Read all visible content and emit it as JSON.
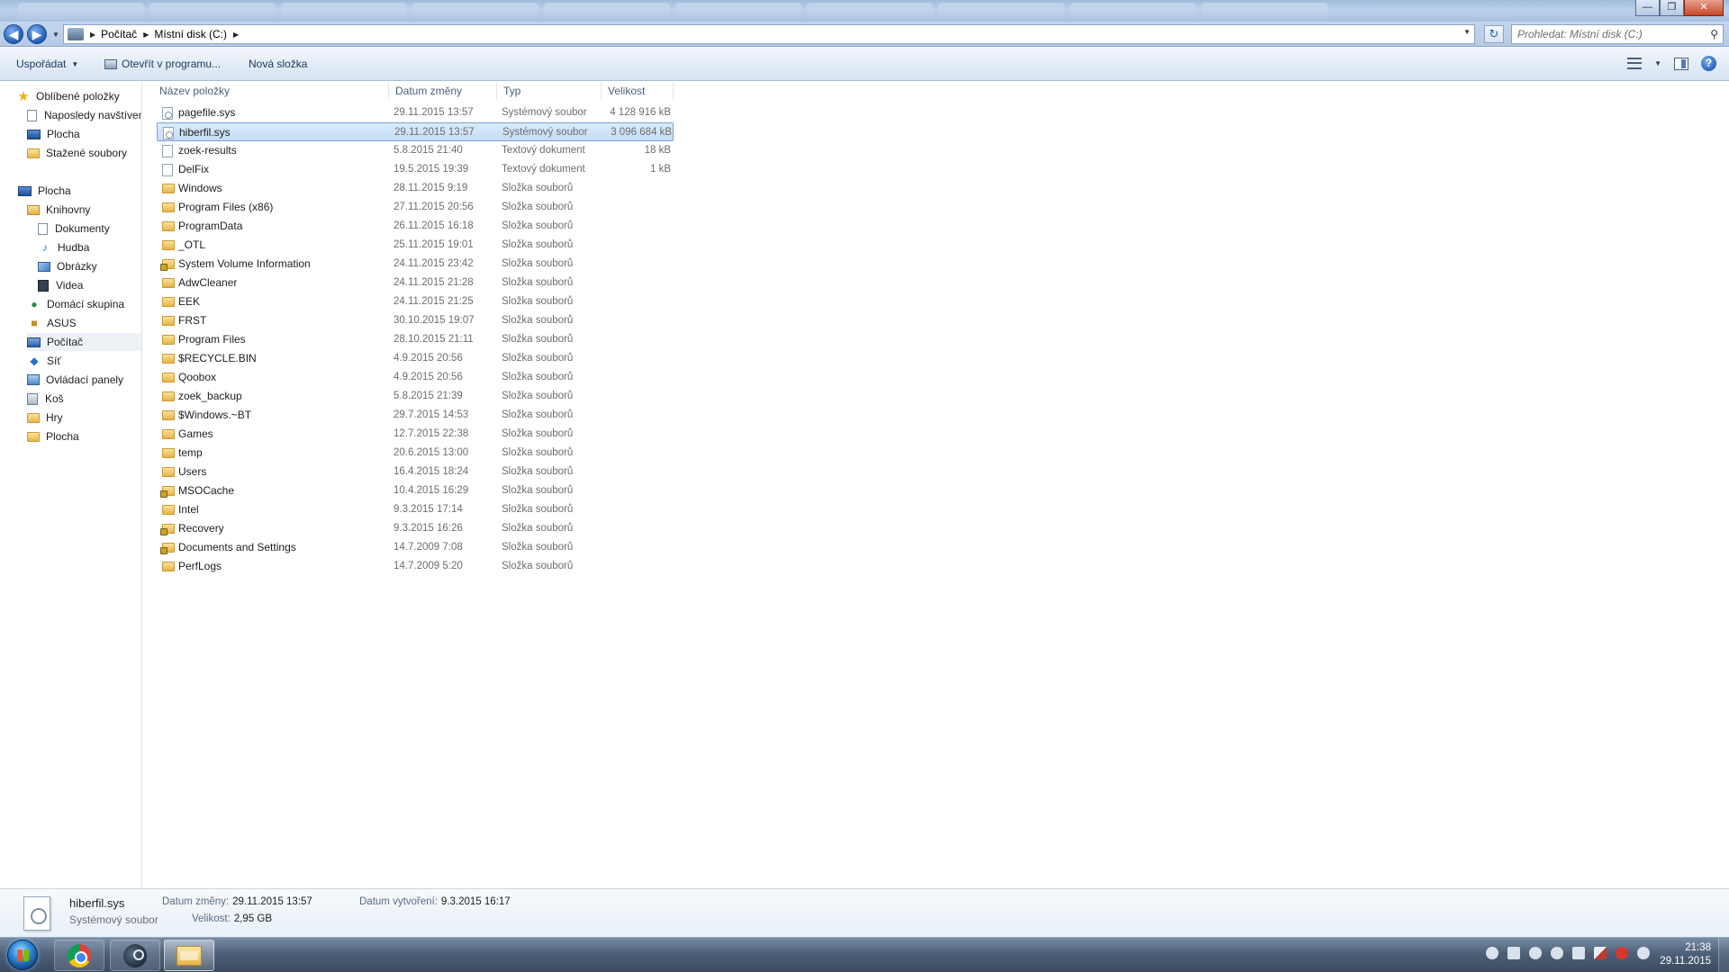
{
  "window": {
    "minimize": "—",
    "maximize": "❐",
    "close": "✕"
  },
  "address": {
    "back": "◀",
    "forward": "▶",
    "crumbs": [
      "Počítač",
      "Místní disk (C:)"
    ],
    "search_placeholder": "Prohledat: Místní disk (C:)"
  },
  "toolbar": {
    "organize": "Uspořádat",
    "open_with": "Otevřít v programu...",
    "new_folder": "Nová složka",
    "help": "?"
  },
  "nav": {
    "favorites": "Oblíbené položky",
    "recent": "Naposledy navštíven",
    "desktop_fav": "Plocha",
    "downloads": "Stažené soubory",
    "desktop": "Plocha",
    "libraries": "Knihovny",
    "documents": "Dokumenty",
    "music": "Hudba",
    "pictures": "Obrázky",
    "videos": "Videa",
    "homegroup": "Domácí skupina",
    "asus": "ASUS",
    "computer": "Počítač",
    "network": "Síť",
    "control_panel": "Ovládací panely",
    "recycle_bin": "Koš",
    "games": "Hry",
    "desktop2": "Plocha"
  },
  "columns": {
    "name": "Název položky",
    "date": "Datum změny",
    "type": "Typ",
    "size": "Velikost"
  },
  "files": [
    {
      "name": "pagefile.sys",
      "date": "29.11.2015 13:57",
      "type": "Systémový soubor",
      "size": "4 128 916 kB"
    },
    {
      "name": "hiberfil.sys",
      "date": "29.11.2015 13:57",
      "type": "Systémový soubor",
      "size": "3 096 684 kB"
    },
    {
      "name": "zoek-results",
      "date": "5.8.2015 21:40",
      "type": "Textový dokument",
      "size": "18 kB"
    },
    {
      "name": "DelFix",
      "date": "19.5.2015 19:39",
      "type": "Textový dokument",
      "size": "1 kB"
    },
    {
      "name": "Windows",
      "date": "28.11.2015 9:19",
      "type": "Složka souborů",
      "size": ""
    },
    {
      "name": "Program Files (x86)",
      "date": "27.11.2015 20:56",
      "type": "Složka souborů",
      "size": ""
    },
    {
      "name": "ProgramData",
      "date": "26.11.2015 16:18",
      "type": "Složka souborů",
      "size": ""
    },
    {
      "name": "_OTL",
      "date": "25.11.2015 19:01",
      "type": "Složka souborů",
      "size": ""
    },
    {
      "name": "System Volume Information",
      "date": "24.11.2015 23:42",
      "type": "Složka souborů",
      "size": ""
    },
    {
      "name": "AdwCleaner",
      "date": "24.11.2015 21:28",
      "type": "Složka souborů",
      "size": ""
    },
    {
      "name": "EEK",
      "date": "24.11.2015 21:25",
      "type": "Složka souborů",
      "size": ""
    },
    {
      "name": "FRST",
      "date": "30.10.2015 19:07",
      "type": "Složka souborů",
      "size": ""
    },
    {
      "name": "Program Files",
      "date": "28.10.2015 21:11",
      "type": "Složka souborů",
      "size": ""
    },
    {
      "name": "$RECYCLE.BIN",
      "date": "4.9.2015 20:56",
      "type": "Složka souborů",
      "size": ""
    },
    {
      "name": "Qoobox",
      "date": "4.9.2015 20:56",
      "type": "Složka souborů",
      "size": ""
    },
    {
      "name": "zoek_backup",
      "date": "5.8.2015 21:39",
      "type": "Složka souborů",
      "size": ""
    },
    {
      "name": "$Windows.~BT",
      "date": "29.7.2015 14:53",
      "type": "Složka souborů",
      "size": ""
    },
    {
      "name": "Games",
      "date": "12.7.2015 22:38",
      "type": "Složka souborů",
      "size": ""
    },
    {
      "name": "temp",
      "date": "20.6.2015 13:00",
      "type": "Složka souborů",
      "size": ""
    },
    {
      "name": "Users",
      "date": "16.4.2015 18:24",
      "type": "Složka souborů",
      "size": ""
    },
    {
      "name": "MSOCache",
      "date": "10.4.2015 16:29",
      "type": "Složka souborů",
      "size": ""
    },
    {
      "name": "Intel",
      "date": "9.3.2015 17:14",
      "type": "Složka souborů",
      "size": ""
    },
    {
      "name": "Recovery",
      "date": "9.3.2015 16:26",
      "type": "Složka souborů",
      "size": ""
    },
    {
      "name": "Documents and Settings",
      "date": "14.7.2009 7:08",
      "type": "Složka souborů",
      "size": ""
    },
    {
      "name": "PerfLogs",
      "date": "14.7.2009 5:20",
      "type": "Složka souborů",
      "size": ""
    }
  ],
  "details": {
    "name": "hiberfil.sys",
    "type": "Systémový soubor",
    "modified_label": "Datum změny:",
    "modified_value": "29.11.2015 13:57",
    "created_label": "Datum vytvoření:",
    "created_value": "9.3.2015 16:17",
    "size_label": "Velikost:",
    "size_value": "2,95 GB"
  },
  "taskbar": {
    "time": "21:38",
    "date": "29.11.2015"
  }
}
